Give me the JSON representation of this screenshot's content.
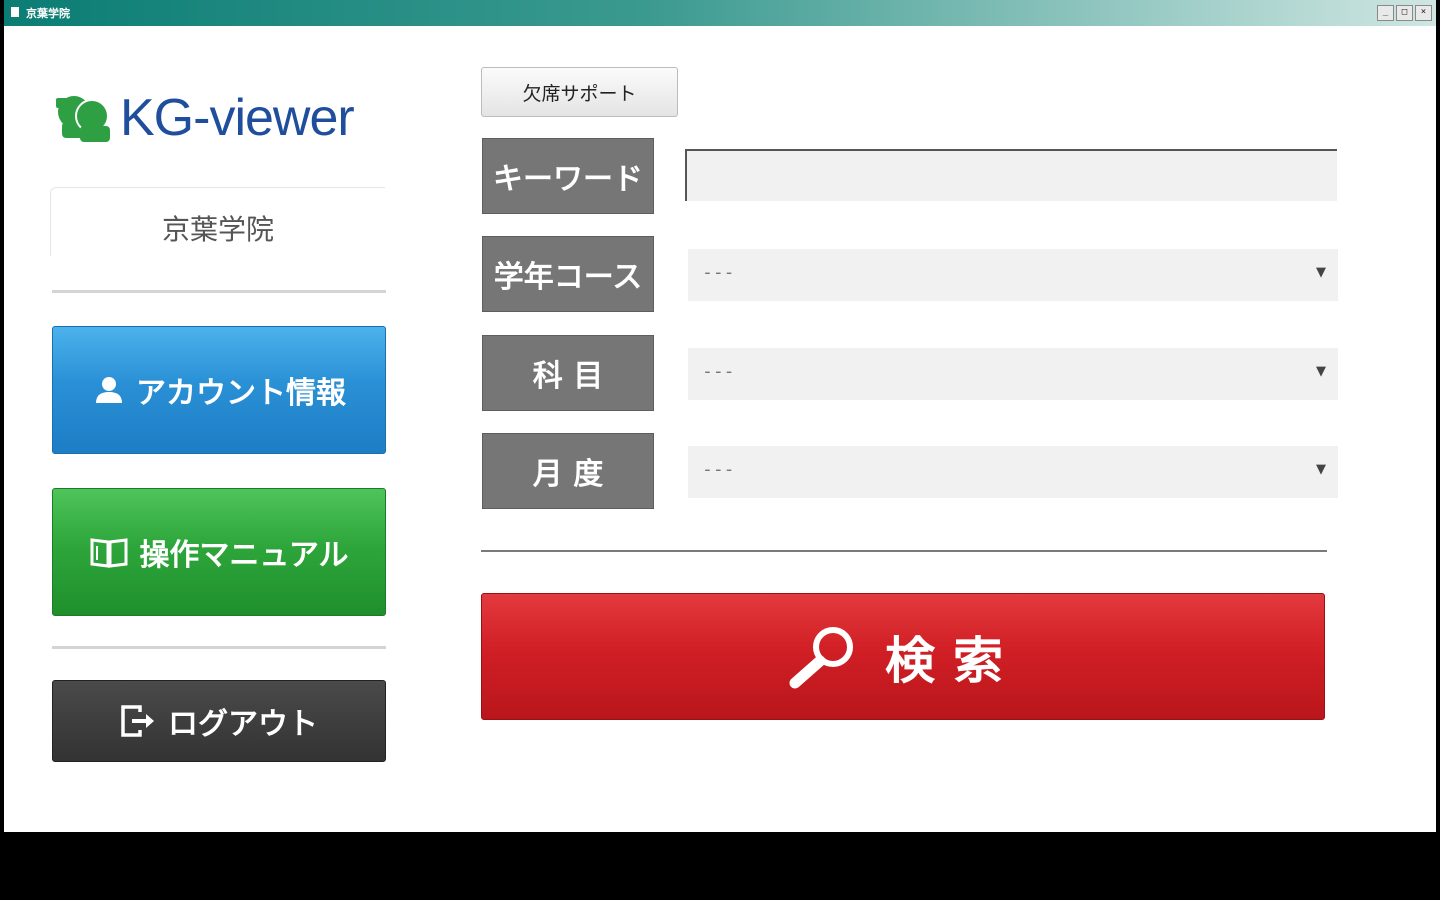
{
  "window": {
    "title": "京葉学院",
    "controls": [
      "_",
      "□",
      "×"
    ]
  },
  "sidebar": {
    "logo_text": "KG-viewer",
    "school_name": "京葉学院",
    "account_button": "アカウント情報",
    "manual_button": "操作マニュアル",
    "logout_button": "ログアウト"
  },
  "form": {
    "support_button": "欠席サポート",
    "keyword_label": "キーワード",
    "keyword_value": "",
    "grade_label": "学年コース",
    "grade_value": "---",
    "subject_label": "科 目",
    "subject_value": "---",
    "month_label": "月 度",
    "month_value": "---",
    "caret": "▼",
    "search_button": "検索"
  },
  "colors": {
    "logo_blue": "#1f4f9c",
    "logo_green": "#2ea043",
    "account_blue": "#2a90d6",
    "manual_green": "#2ea63b",
    "logout_dark": "#3a3a3a",
    "search_red": "#d01f25",
    "label_gray": "#767676"
  },
  "icons": {
    "account": "user-icon",
    "manual": "book-icon",
    "logout": "logout-icon",
    "search": "magnifier-icon"
  }
}
